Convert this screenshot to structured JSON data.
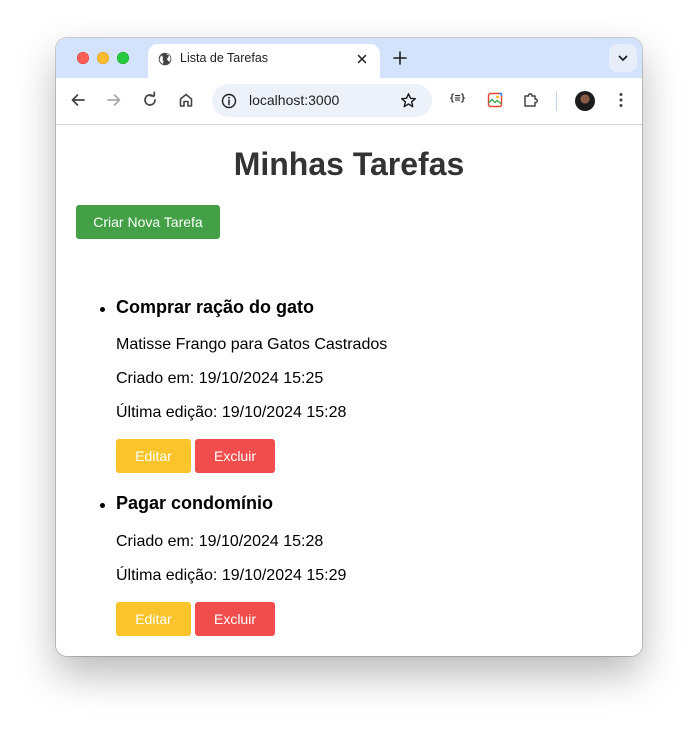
{
  "browser": {
    "tab_title": "Lista de Tarefas",
    "url": "localhost:3000",
    "extension_label": "{≡}"
  },
  "page": {
    "heading": "Minhas Tarefas",
    "create_button_label": "Criar Nova Tarefa",
    "tasks": [
      {
        "title": "Comprar ração do gato",
        "description": "Matisse Frango para Gatos Castrados",
        "created": "Criado em: 19/10/2024 15:25",
        "edited": "Última edição: 19/10/2024 15:28",
        "edit_label": "Editar",
        "delete_label": "Excluir"
      },
      {
        "title": "Pagar condomínio",
        "created": "Criado em: 19/10/2024 15:28",
        "edited": "Última edição: 19/10/2024 15:29",
        "edit_label": "Editar",
        "delete_label": "Excluir"
      }
    ]
  },
  "colors": {
    "create_button": "#43a047",
    "edit_button": "#fbc42a",
    "delete_button": "#f24d4d",
    "tab_strip": "#d3e3fd"
  },
  "icons": [
    "globe-icon",
    "close-icon",
    "plus-icon",
    "chevron-down-icon",
    "back-arrow-icon",
    "forward-arrow-icon",
    "reload-icon",
    "home-icon",
    "info-icon",
    "star-icon",
    "extensions-puzzle-icon",
    "menu-kebab-icon"
  ]
}
